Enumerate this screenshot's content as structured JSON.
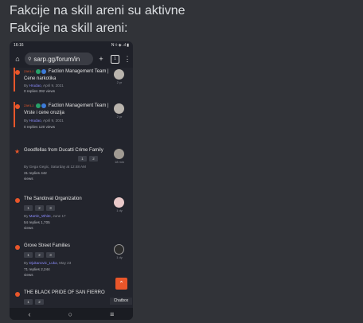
{
  "message": {
    "line1": "Fakcije na skill areni su aktivne",
    "line2": "Fakcije na skill areni:"
  },
  "phone": {
    "status": {
      "time": "16:16",
      "indicators": "N ◊ ◈ .ıl ▮"
    },
    "browser": {
      "url": "sarp.gg/forum/in",
      "home_icon": "home-icon",
      "new_tab_label": "+",
      "tab_count": "1",
      "menu_label": "⋮"
    },
    "threads": [
      {
        "marker": "dot",
        "flag": "ZAKLJ.",
        "title": "Faction Management Team | Cene narkotika",
        "author": "Hrudao",
        "date": "April 9, 2021",
        "stats": "0 replies   392 views",
        "ago": "2 yr"
      },
      {
        "marker": "dot",
        "flag": "ZAKLJ.",
        "title": "Faction Management Team | Vrste i cene oruzija",
        "author": "Hrudao",
        "date": "April 9, 2021",
        "stats": "0 replies   120 views",
        "ago": "2 yr"
      },
      {
        "marker": "star",
        "title": "Goodfellas from Ducatti Crime Family",
        "author": "Gega Gegic",
        "date": "Saturday at 12:48 AM",
        "stats": "31 replies   442",
        "stats2": "views",
        "pages": [
          "1",
          "2"
        ],
        "ago": "18 min"
      },
      {
        "marker": "dot",
        "title": "The Sandoval Organization",
        "author": "Martin_White",
        "date": "June 17",
        "stats": "54 replies   1,705",
        "stats2": "views",
        "pages": [
          "1",
          "2",
          "3"
        ],
        "ago": "1 dy"
      },
      {
        "marker": "dot",
        "title": "Grove Street Families",
        "author": "Djukanovic_Luka",
        "date": "May 23",
        "stats": "71 replies   2,244",
        "stats2": "views",
        "pages": [
          "1",
          "2",
          "3"
        ],
        "ago": "1 dy"
      },
      {
        "marker": "dot",
        "title": "THE BLACK PRIDE OF SAN FIERRO",
        "pages": [
          "1",
          "2"
        ]
      }
    ],
    "chatbox": {
      "label": "Chatbox",
      "button": "⌃"
    },
    "navbar": {
      "back": "‹",
      "home": "○",
      "recents": "≡"
    }
  }
}
